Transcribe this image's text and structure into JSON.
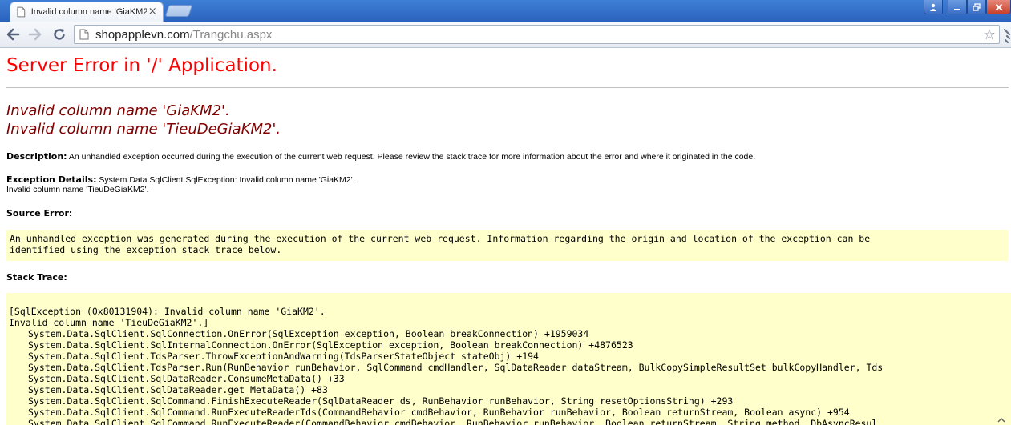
{
  "browser": {
    "tab_title": "Invalid column name 'GiaKM2",
    "tab_close": "×",
    "url_host": "shopapplevn.com",
    "url_path": "/Trangchu.aspx"
  },
  "page": {
    "heading": "Server Error in '/' Application.",
    "error_title_lines": [
      "Invalid column name 'GiaKM2'.",
      "Invalid column name 'TieuDeGiaKM2'."
    ],
    "description_label": "Description:",
    "description_text": " An unhandled exception occurred during the execution of the current web request. Please review the stack trace for more information about the error and where it originated in the code.",
    "exception_label": "Exception Details:",
    "exception_text": " System.Data.SqlClient.SqlException: Invalid column name 'GiaKM2'.",
    "exception_text_2": "Invalid column name 'TieuDeGiaKM2'.",
    "source_error_label": "Source Error:",
    "source_error_lines": [
      "An unhandled exception was generated during the execution of the current web request. Information regarding the origin and location of the exception can be",
      "identified using the exception stack trace below."
    ],
    "stack_trace_label": "Stack Trace:",
    "stack_trace_lines": [
      "[SqlException (0x80131904): Invalid column name 'GiaKM2'.",
      "Invalid column name 'TieuDeGiaKM2'.]",
      "System.Data.SqlClient.SqlConnection.OnError(SqlException exception, Boolean breakConnection) +1959034",
      "System.Data.SqlClient.SqlInternalConnection.OnError(SqlException exception, Boolean breakConnection) +4876523",
      "System.Data.SqlClient.TdsParser.ThrowExceptionAndWarning(TdsParserStateObject stateObj) +194",
      "System.Data.SqlClient.TdsParser.Run(RunBehavior runBehavior, SqlCommand cmdHandler, SqlDataReader dataStream, BulkCopySimpleResultSet bulkCopyHandler, Tds",
      "System.Data.SqlClient.SqlDataReader.ConsumeMetaData() +33",
      "System.Data.SqlClient.SqlDataReader.get_MetaData() +83",
      "System.Data.SqlClient.SqlCommand.FinishExecuteReader(SqlDataReader ds, RunBehavior runBehavior, String resetOptionsString) +293",
      "System.Data.SqlClient.SqlCommand.RunExecuteReaderTds(CommandBehavior cmdBehavior, RunBehavior runBehavior, Boolean returnStream, Boolean async) +954",
      "System.Data.SqlClient.SqlCommand.RunExecuteReader(CommandBehavior cmdBehavior, RunBehavior runBehavior, Boolean returnStream, String method, DbAsyncResul"
    ]
  },
  "colors": {
    "heading": "#ff0000",
    "error_title": "#800000",
    "code_background": "#ffffcc"
  },
  "icons": {
    "back": "arrow-left-icon",
    "forward": "arrow-right-icon",
    "reload": "reload-icon",
    "page": "page-icon",
    "star": "star-icon",
    "wrench": "wrench-icon"
  }
}
